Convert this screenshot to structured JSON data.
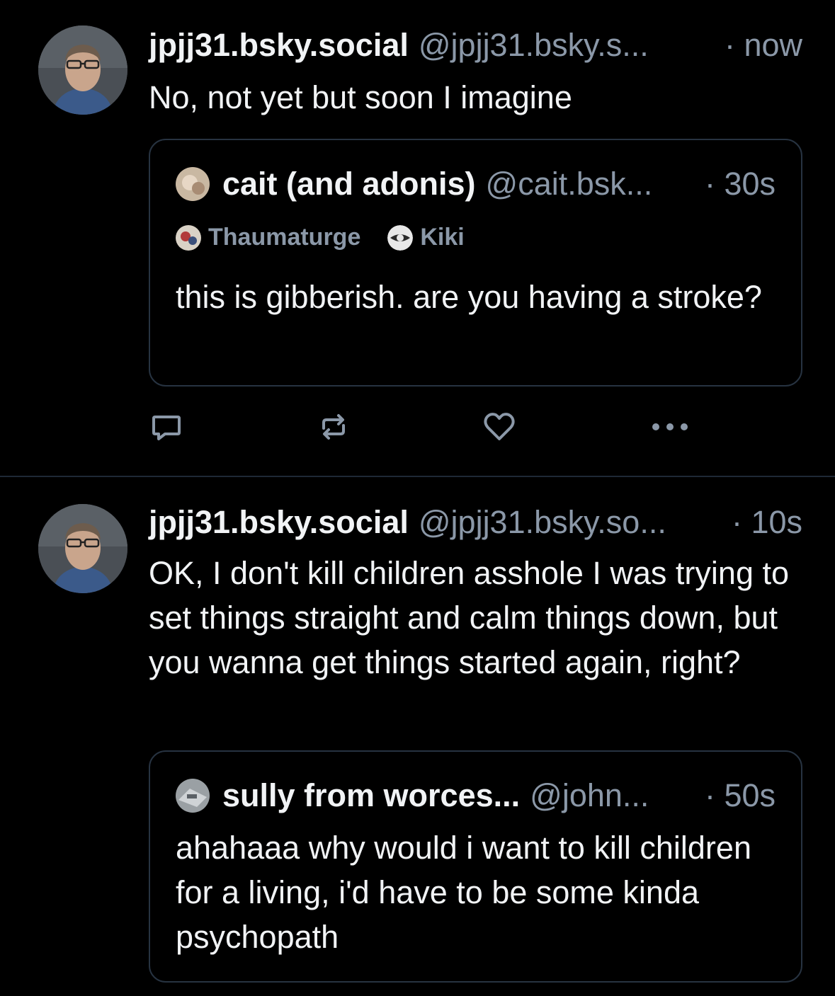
{
  "posts": [
    {
      "author": {
        "display_name": "jpjj31.bsky.social",
        "handle": "@jpjj31.bsky.s...",
        "avatar_icon": "user-avatar"
      },
      "time": "· now",
      "text": "No, not yet but soon I imagine",
      "quote": {
        "display_name": "cait (and adonis)",
        "handle": "@cait.bsk...",
        "time": "· 30s",
        "labels": [
          {
            "name": "Thaumaturge",
            "icon": "labeler-avatar"
          },
          {
            "name": "Kiki",
            "icon": "labeler-avatar"
          }
        ],
        "text": "this is gibberish. are you having a stroke?"
      },
      "actions": [
        "reply-icon",
        "repost-icon",
        "like-icon",
        "more-icon"
      ]
    },
    {
      "author": {
        "display_name": "jpjj31.bsky.social",
        "handle": "@jpjj31.bsky.so...",
        "avatar_icon": "user-avatar"
      },
      "time": "· 10s",
      "text": "OK, I don't kill children asshole I was trying to set things straight and calm things down, but you wanna get things started again, right?",
      "quote": {
        "display_name": "sully from worces...",
        "handle": "@john...",
        "time": "· 50s",
        "text": "ahahaaa why would i want to kill children for a living, i'd have to be some kinda psychopath"
      }
    }
  ],
  "colors": {
    "background": "#000000",
    "text_primary": "#f1f3f5",
    "text_secondary": "#8b98a8",
    "border": "#273341",
    "divider": "#1e2936"
  }
}
